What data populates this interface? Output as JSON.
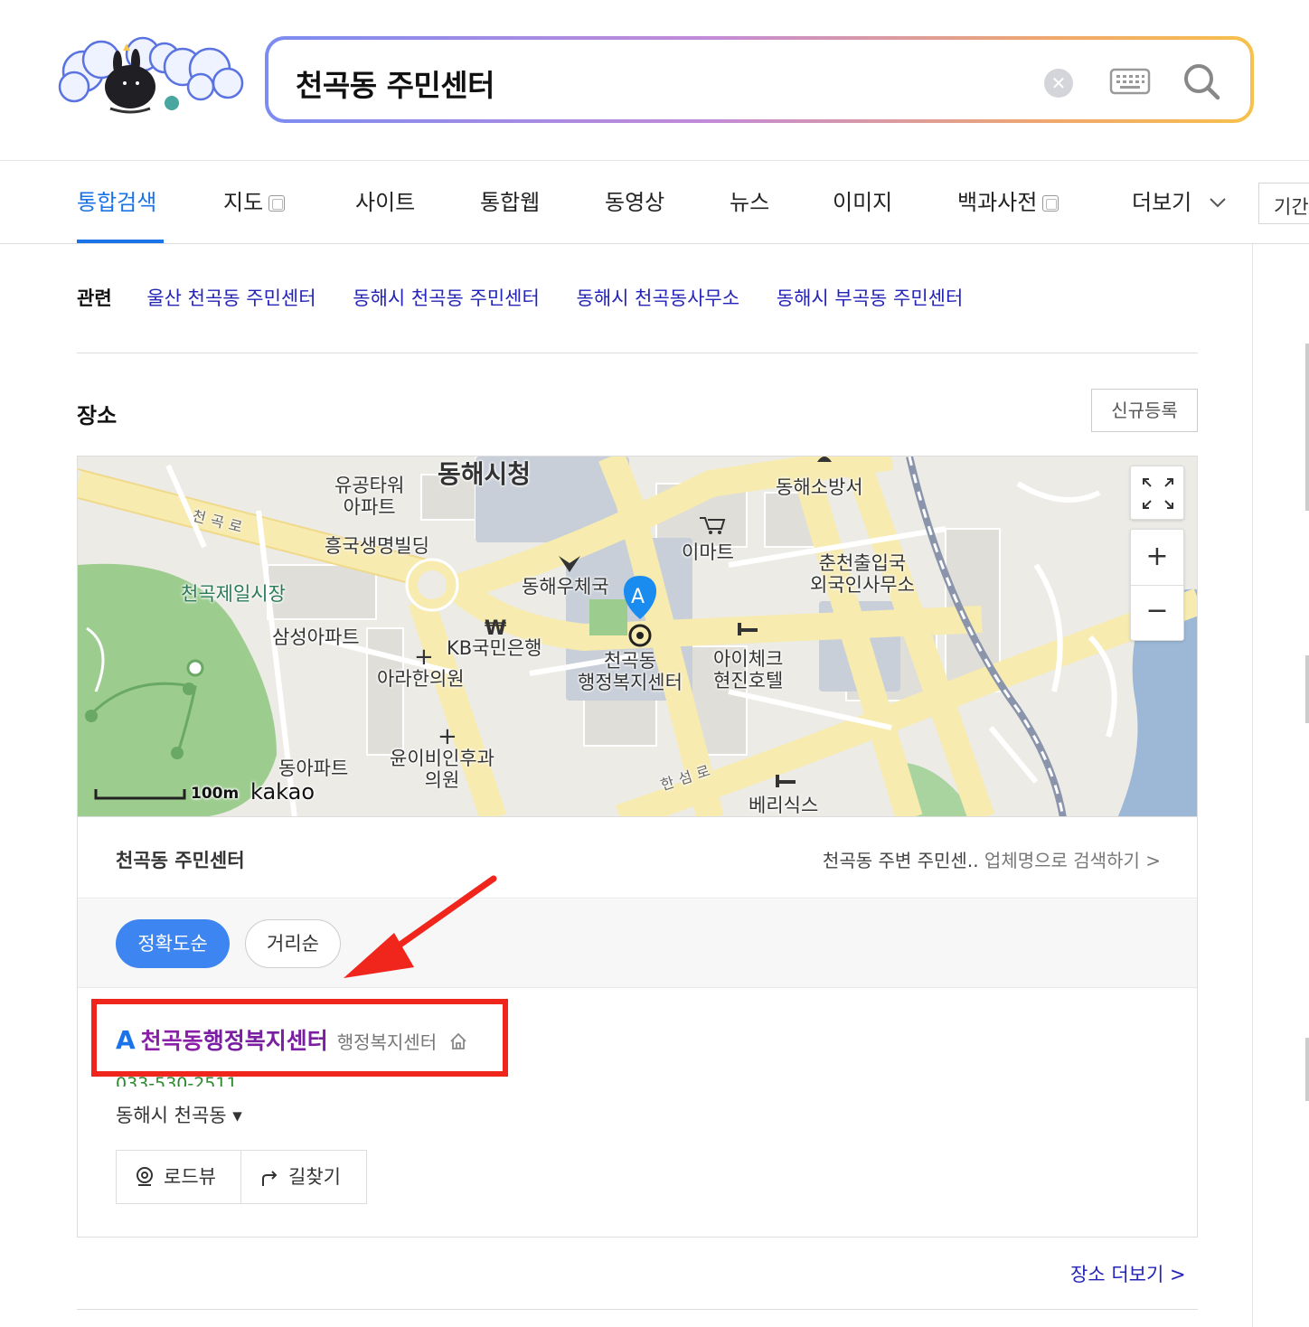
{
  "search": {
    "query": "천곡동 주민센터",
    "clear_icon": "clear-icon",
    "keyboard_icon": "keyboard-icon",
    "search_icon": "search-icon"
  },
  "tabs": [
    {
      "label": "통합검색",
      "active": true
    },
    {
      "label": "지도",
      "new_window": true
    },
    {
      "label": "사이트"
    },
    {
      "label": "통합웹"
    },
    {
      "label": "동영상"
    },
    {
      "label": "뉴스"
    },
    {
      "label": "이미지"
    },
    {
      "label": "백과사전",
      "new_window": true
    },
    {
      "label": "더보기"
    }
  ],
  "period_label": "기간",
  "related": {
    "label": "관련",
    "links": [
      "울산 천곡동 주민센터",
      "동해시 천곡동 주민센터",
      "동해시 천곡동사무소",
      "동해시 부곡동 주민센터"
    ]
  },
  "places": {
    "title": "장소",
    "register_label": "신규등록",
    "map": {
      "labels": {
        "city_hall": "동해시청",
        "apt1": "유공타워\n아파트",
        "fire": "동해소방서",
        "heungkuk": "흥국생명빌딩",
        "emart": "이마트",
        "immigration": "춘천출입국\n외국인사무소",
        "market": "천곡제일시장",
        "post": "동해우체국",
        "samsung": "삼성아파트",
        "kb": "KB국민은행",
        "arahan": "아라한의원",
        "center": "천곡동\n행정복지센터",
        "hotel": "아이체크\n현진호텔",
        "dongah": "동아파트",
        "yun": "윤이비인후과\n의원",
        "berry": "베리식스",
        "road1": "천곡로",
        "road2": "한섬로",
        "scale": "100m",
        "brand": "kakao",
        "marker": "A"
      },
      "colors": {
        "park": "#9ccc8e",
        "road": "#f7ebb0",
        "water": "#9cb8d6",
        "marker": "#1a8cf0"
      }
    },
    "result": {
      "title": "천곡동 주민센터",
      "nearby_link_dark": "천곡동 주변 주민센..",
      "nearby_link_gray": "업체명으로 검색하기 >",
      "sort_options": [
        "정확도순",
        "거리순"
      ],
      "active_sort": "정확도순",
      "item": {
        "letter": "A",
        "name_highlight": "천곡동",
        "name_rest": "행정복지센터",
        "category": "행정복지센터",
        "phone": "033-530-2511",
        "address": "동해시 천곡동 ▾",
        "roadview_label": "로드뷰",
        "route_label": "길찾기"
      }
    },
    "more_label": "장소 더보기 >"
  },
  "annotation": {
    "color": "#f0261d"
  }
}
